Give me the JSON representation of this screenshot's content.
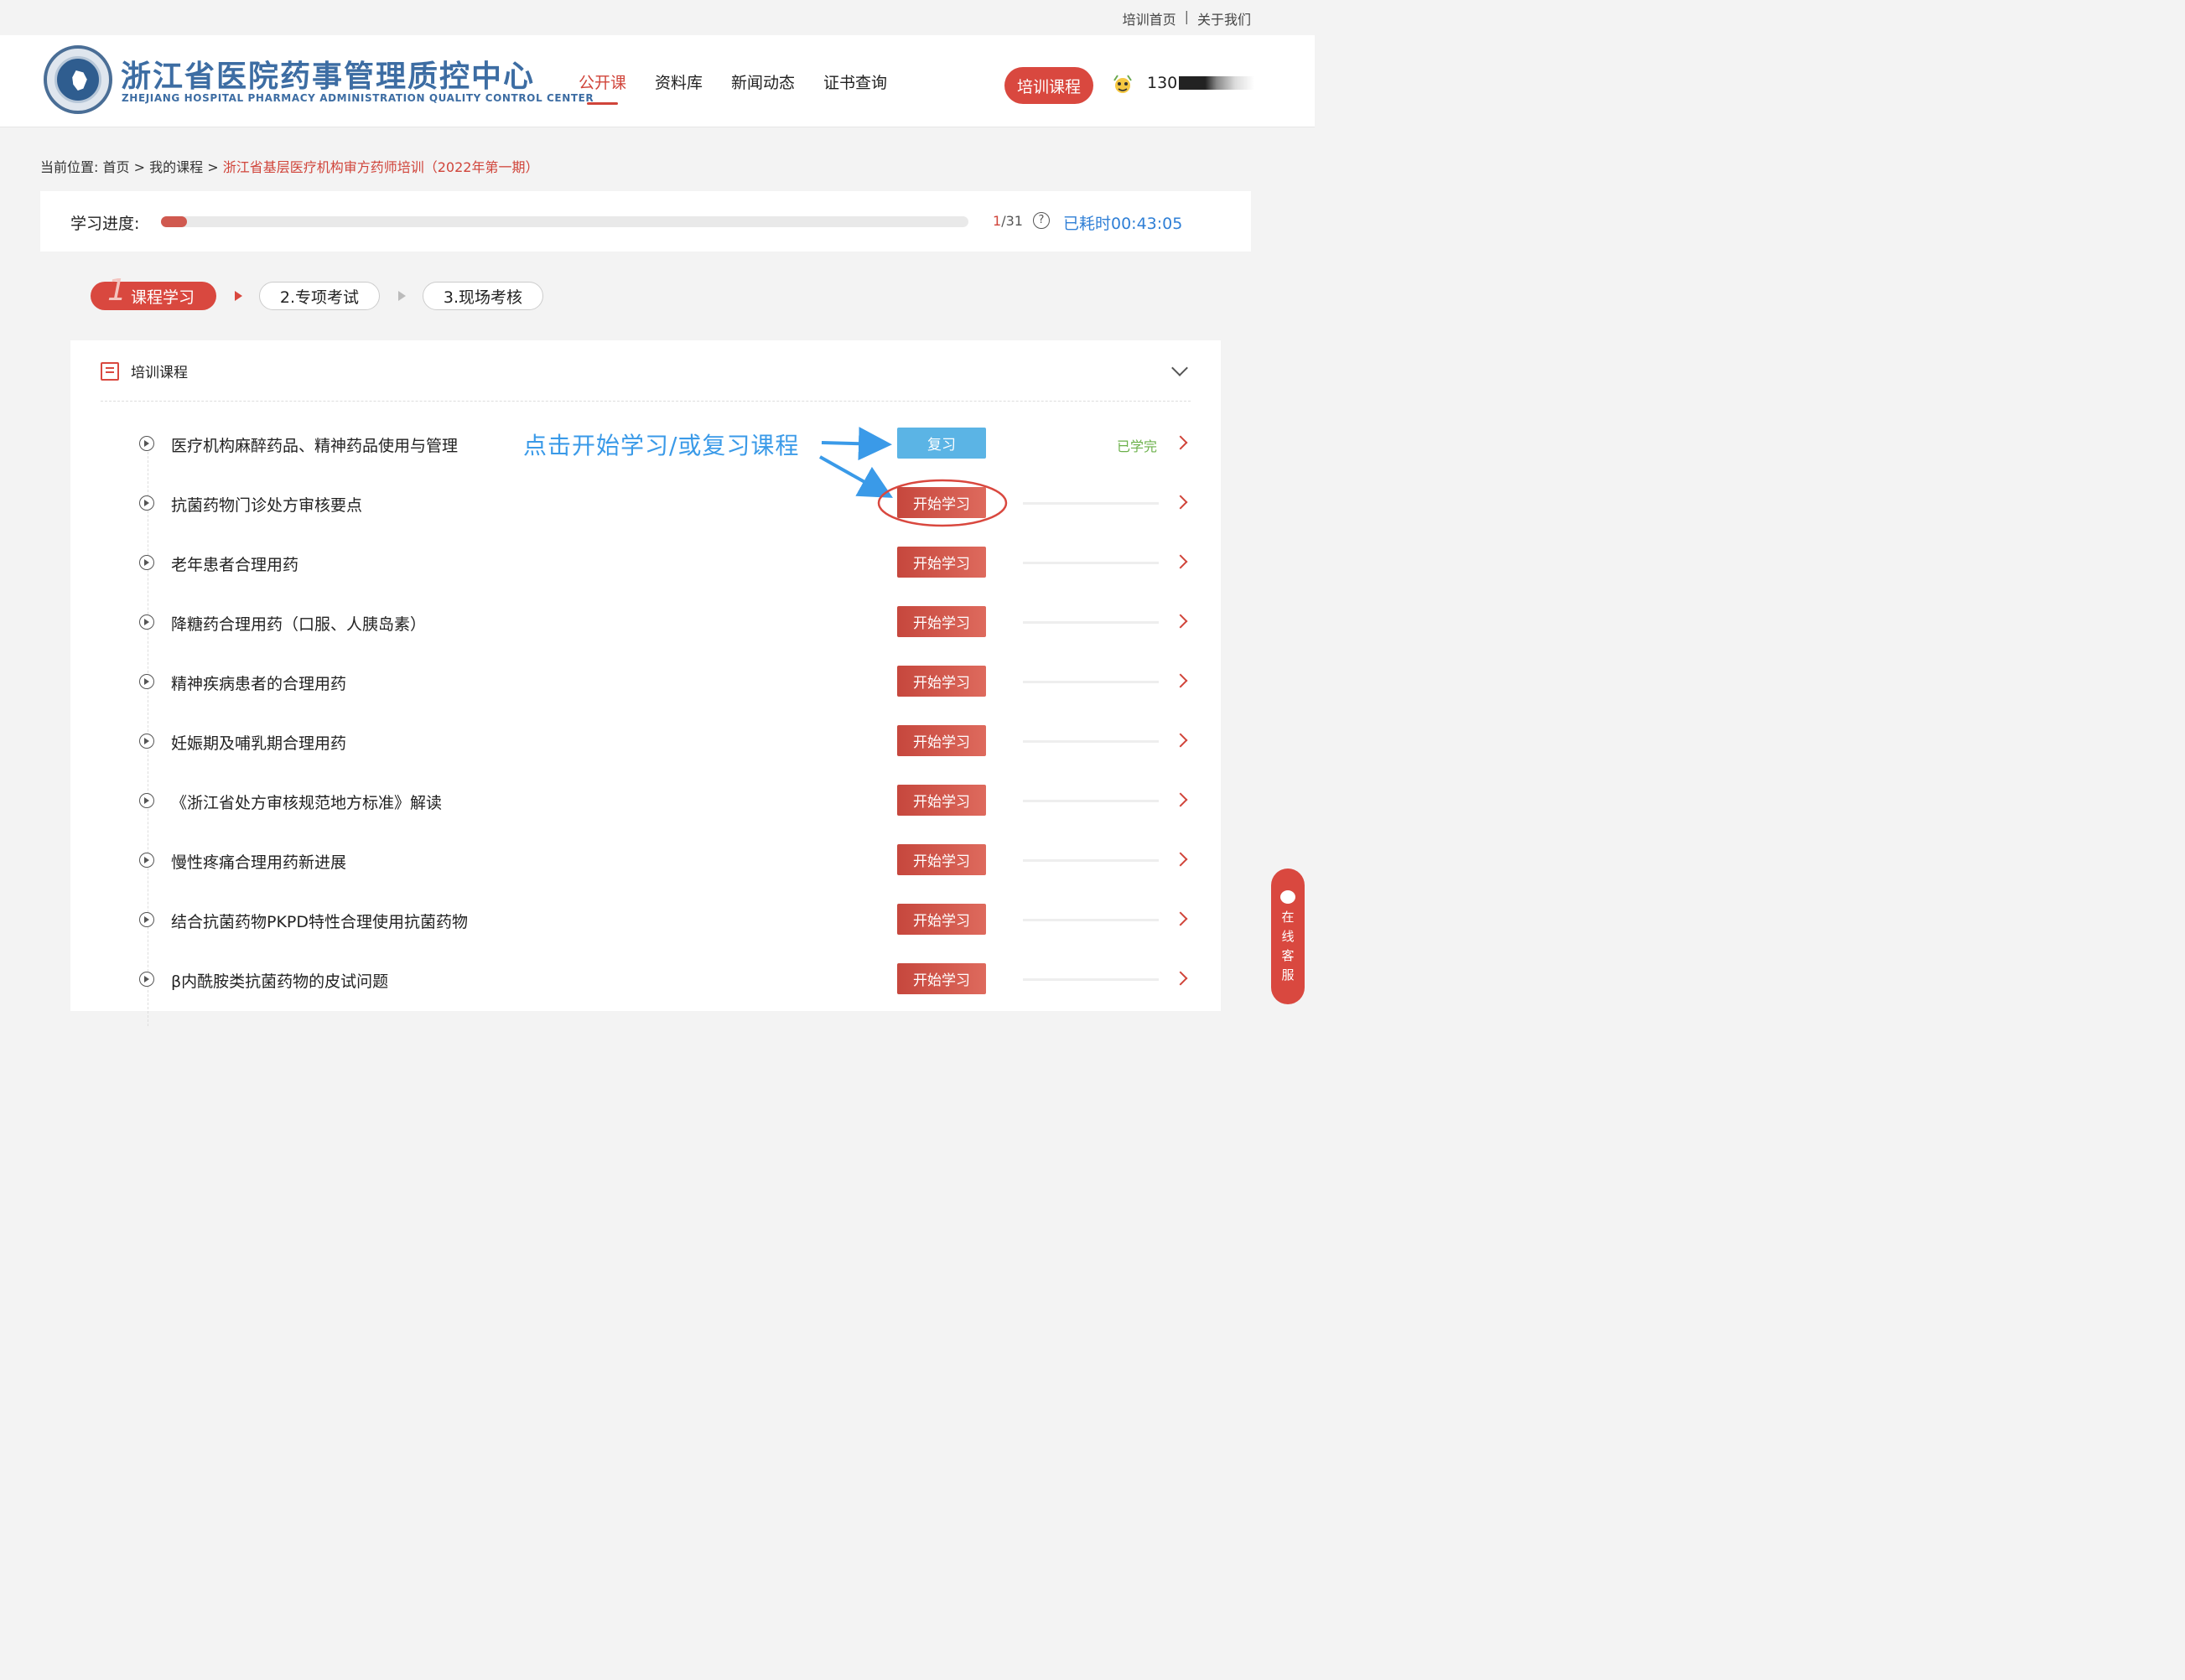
{
  "topbar": {
    "home_link": "培训首页",
    "separator": "|",
    "about_link": "关于我们"
  },
  "header": {
    "logo_title": "浙江省医院药事管理质控中心",
    "logo_subtitle": "ZHEJIANG HOSPITAL PHARMACY ADMINISTRATION QUALITY CONTROL CENTER",
    "nav": [
      "公开课",
      "资料库",
      "新闻动态",
      "证书查询"
    ],
    "active_nav": "公开课",
    "training_button": "培训课程",
    "user_id": "130"
  },
  "breadcrumb": {
    "prefix": "当前位置:",
    "home": "首页",
    "sep1": ">",
    "my_courses": "我的课程",
    "sep2": ">",
    "current": "浙江省基层医疗机构审方药师培训（2022年第一期）"
  },
  "progress": {
    "label": "学习进度:",
    "completed": "1",
    "total": "/31",
    "fraction": 0.032,
    "help": "?",
    "elapsed": "已耗时00:43:05"
  },
  "steps": [
    {
      "num": "1",
      "label": "课程学习",
      "active": true
    },
    {
      "label": "2.专项考试",
      "active": false
    },
    {
      "label": "3.现场考核",
      "active": false
    }
  ],
  "panel": {
    "title": "培训课程"
  },
  "annotation": "点击开始学习/或复习课程",
  "courses": [
    {
      "title": "医疗机构麻醉药品、精神药品使用与管理",
      "button": "复习",
      "status": "已学完"
    },
    {
      "title": "抗菌药物门诊处方审核要点",
      "button": "开始学习",
      "status": ""
    },
    {
      "title": "老年患者合理用药",
      "button": "开始学习",
      "status": ""
    },
    {
      "title": "降糖药合理用药（口服、人胰岛素）",
      "button": "开始学习",
      "status": ""
    },
    {
      "title": "精神疾病患者的合理用药",
      "button": "开始学习",
      "status": ""
    },
    {
      "title": "妊娠期及哺乳期合理用药",
      "button": "开始学习",
      "status": ""
    },
    {
      "title": "《浙江省处方审核规范地方标准》解读",
      "button": "开始学习",
      "status": ""
    },
    {
      "title": "慢性疼痛合理用药新进展",
      "button": "开始学习",
      "status": ""
    },
    {
      "title": "结合抗菌药物PKPD特性合理使用抗菌药物",
      "button": "开始学习",
      "status": ""
    },
    {
      "title": "β内酰胺类抗菌药物的皮试问题",
      "button": "开始学习",
      "status": ""
    }
  ],
  "customer_service": "在线客服",
  "colors": {
    "primary": "#d9483f",
    "link_blue": "#2f7fd6",
    "review_blue": "#5bb4e5",
    "done_green": "#6bb04a"
  }
}
